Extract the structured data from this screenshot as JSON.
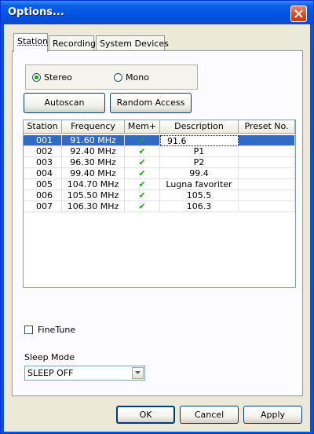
{
  "window": {
    "title": "Options..."
  },
  "tabs": [
    {
      "label": "Station",
      "active": true
    },
    {
      "label": "Recording",
      "active": false
    },
    {
      "label": "System Devices",
      "active": false
    }
  ],
  "mode": {
    "stereo_label": "Stereo",
    "mono_label": "Mono",
    "selected": "Stereo"
  },
  "buttons": {
    "autoscan": "Autoscan",
    "random_access": "Random Access",
    "ok": "OK",
    "cancel": "Cancel",
    "apply": "Apply"
  },
  "station_list": {
    "columns": [
      "Station",
      "Frequency",
      "Mem+",
      "Description",
      "Preset No."
    ],
    "rows": [
      {
        "station": "001",
        "frequency": "91.60 MHz",
        "mem": true,
        "description": "91.6",
        "preset": "",
        "selected": true
      },
      {
        "station": "002",
        "frequency": "92.40 MHz",
        "mem": true,
        "description": "P1",
        "preset": ""
      },
      {
        "station": "003",
        "frequency": "96.30 MHz",
        "mem": true,
        "description": "P2",
        "preset": ""
      },
      {
        "station": "004",
        "frequency": "99.40 MHz",
        "mem": true,
        "description": "99.4",
        "preset": ""
      },
      {
        "station": "005",
        "frequency": "104.70 MHz",
        "mem": true,
        "description": "Lugna favoriter",
        "preset": ""
      },
      {
        "station": "006",
        "frequency": "105.50 MHz",
        "mem": true,
        "description": "105.5",
        "preset": ""
      },
      {
        "station": "007",
        "frequency": "106.30 MHz",
        "mem": true,
        "description": "106.3",
        "preset": ""
      }
    ]
  },
  "finetune": {
    "label": "FineTune",
    "checked": false
  },
  "sleep": {
    "label": "Sleep Mode",
    "value": "SLEEP OFF"
  },
  "colors": {
    "title_bar": "#0054e3",
    "selection": "#316ac5",
    "check": "#22a322",
    "dialog_bg": "#ece9d8"
  }
}
